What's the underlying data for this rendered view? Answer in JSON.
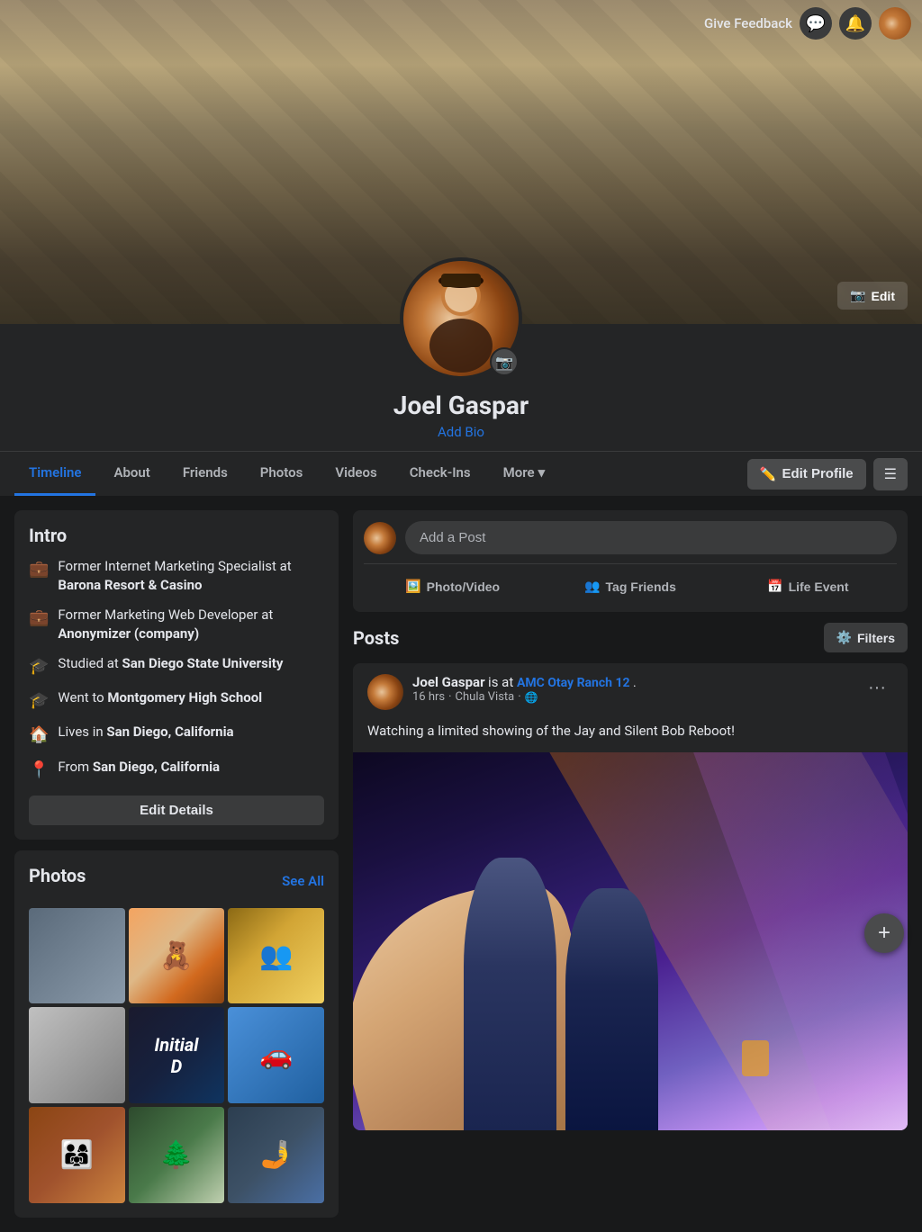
{
  "topbar": {
    "give_feedback_label": "Give Feedback",
    "messenger_icon": "💬",
    "notifications_icon": "🔔"
  },
  "cover": {
    "edit_label": "Edit"
  },
  "profile": {
    "name": "Joel Gaspar",
    "add_bio_label": "Add Bio",
    "camera_icon": "📷"
  },
  "nav": {
    "tabs": [
      {
        "label": "Timeline",
        "active": true
      },
      {
        "label": "About"
      },
      {
        "label": "Friends"
      },
      {
        "label": "Photos"
      },
      {
        "label": "Videos"
      },
      {
        "label": "Check-Ins"
      },
      {
        "label": "More"
      }
    ],
    "edit_profile_label": "Edit Profile",
    "edit_profile_icon": "✏️",
    "menu_icon": "☰"
  },
  "intro": {
    "title": "Intro",
    "items": [
      {
        "icon": "💼",
        "text": "Former Internet Marketing Specialist at ",
        "bold": "Barona Resort & Casino"
      },
      {
        "icon": "💼",
        "text": "Former Marketing Web Developer at ",
        "bold": "Anonymizer (company)"
      },
      {
        "icon": "🎓",
        "text": "Studied at ",
        "bold": "San Diego State University"
      },
      {
        "icon": "🎓",
        "text": "Went to ",
        "bold": "Montgomery High School"
      },
      {
        "icon": "🏠",
        "text": "Lives in ",
        "bold": "San Diego, California"
      },
      {
        "icon": "📍",
        "text": "From ",
        "bold": "San Diego, California"
      }
    ],
    "edit_details_label": "Edit Details"
  },
  "photos_section": {
    "title": "Photos",
    "see_all_label": "See All",
    "count": 9
  },
  "add_post": {
    "placeholder": "Add a Post",
    "actions": [
      {
        "icon": "🖼️",
        "label": "Photo/Video"
      },
      {
        "icon": "👥",
        "label": "Tag Friends"
      },
      {
        "icon": "📅",
        "label": "Life Event"
      }
    ]
  },
  "posts_section": {
    "title": "Posts",
    "filters_label": "Filters",
    "filters_icon": "⚙️"
  },
  "post": {
    "author": "Joel Gaspar",
    "checked_in": "AMC Otay Ranch 12",
    "time": "16 hrs",
    "location": "Chula Vista",
    "globe_icon": "🌐",
    "text": "Watching a limited showing of the Jay and Silent Bob Reboot!",
    "more_icon": "•••"
  },
  "fab": {
    "icon": "+"
  }
}
